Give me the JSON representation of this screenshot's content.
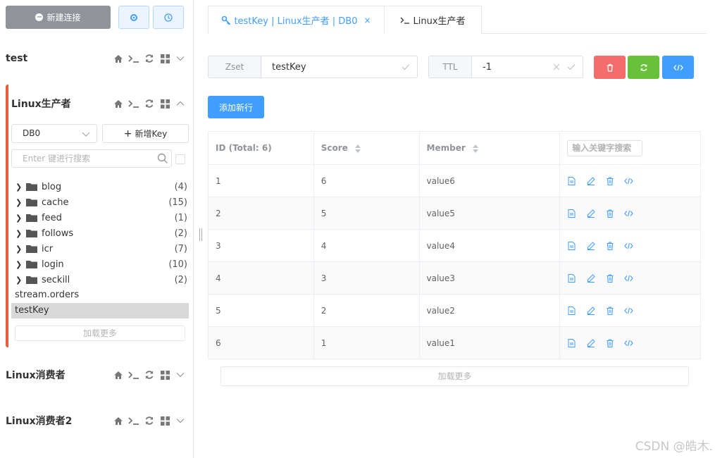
{
  "toolbar": {
    "new_connection_label": "新建连接",
    "settings_icon": "gear-icon",
    "history_icon": "clock-icon"
  },
  "connections": [
    {
      "name": "test"
    },
    {
      "name": "Linux生产者"
    },
    {
      "name": "Linux消费者"
    },
    {
      "name": "Linux消费者2"
    }
  ],
  "active_connection": {
    "db_select": "DB0",
    "add_key_label": "新增Key",
    "search_placeholder": "Enter 键进行搜索",
    "folders": [
      {
        "name": "blog",
        "count": "(4)"
      },
      {
        "name": "cache",
        "count": "(15)"
      },
      {
        "name": "feed",
        "count": "(1)"
      },
      {
        "name": "follows",
        "count": "(2)"
      },
      {
        "name": "icr",
        "count": "(7)"
      },
      {
        "name": "login",
        "count": "(10)"
      },
      {
        "name": "seckill",
        "count": "(2)"
      }
    ],
    "keys": [
      {
        "name": "stream.orders"
      },
      {
        "name": "testKey"
      }
    ],
    "load_more": "加载更多"
  },
  "tabs": [
    {
      "label": "testKey | Linux生产者 | DB0",
      "close": "×"
    },
    {
      "label": "Linux生产者"
    }
  ],
  "key_detail": {
    "type_label": "Zset",
    "key_name": "testKey",
    "ttl_label": "TTL",
    "ttl_value": "-1",
    "add_row_label": "添加新行"
  },
  "table": {
    "headers": {
      "id": "ID (Total: 6)",
      "score": "Score",
      "member": "Member"
    },
    "search_placeholder": "输入关键字搜索",
    "rows": [
      {
        "id": "1",
        "score": "6",
        "member": "value6"
      },
      {
        "id": "2",
        "score": "5",
        "member": "value5"
      },
      {
        "id": "3",
        "score": "4",
        "member": "value4"
      },
      {
        "id": "4",
        "score": "3",
        "member": "value3"
      },
      {
        "id": "5",
        "score": "2",
        "member": "value2"
      },
      {
        "id": "6",
        "score": "1",
        "member": "value1"
      }
    ],
    "load_more": "加载更多"
  },
  "colors": {
    "accent": "#409eff",
    "danger": "#f56c6c",
    "success": "#67c23a",
    "active_border": "#e55f3c"
  },
  "watermark": "CSDN @皓木."
}
